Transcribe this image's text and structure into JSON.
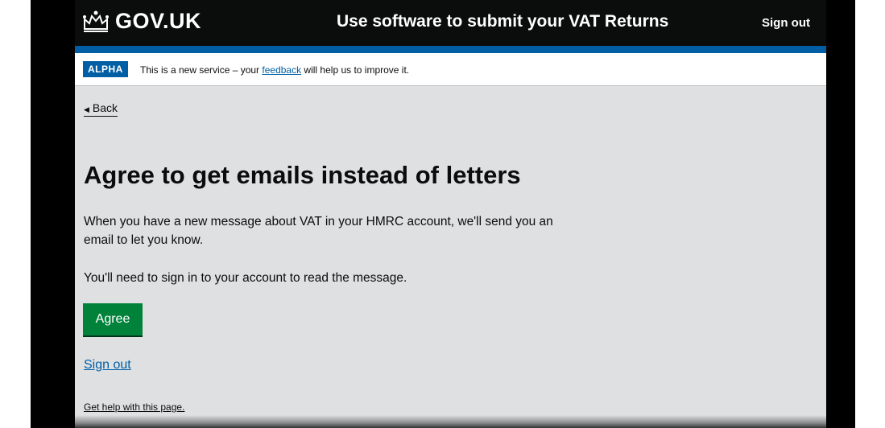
{
  "header": {
    "logo_text": "GOV.UK",
    "service_name": "Use software to submit your VAT Returns",
    "sign_out": "Sign out"
  },
  "phase_banner": {
    "tag": "ALPHA",
    "text_before": "This is a new service – your ",
    "link_text": "feedback",
    "text_after": " will help us to improve it."
  },
  "back_link": "Back",
  "main": {
    "heading": "Agree to get emails instead of letters",
    "paragraph_1": "When you have a new message about VAT in your HMRC account, we'll send you an email to let you know.",
    "paragraph_2": "You'll need to sign in to your account to read the message.",
    "agree_button": "Agree",
    "sign_out_link": "Sign out",
    "help_link": "Get help with this page."
  },
  "colors": {
    "header_bg": "#0b0c0c",
    "brand_blue": "#005ea5",
    "button_green": "#00823b",
    "page_bg": "#dee0e2"
  },
  "icons": [
    "crown-icon",
    "back-arrow-icon"
  ]
}
